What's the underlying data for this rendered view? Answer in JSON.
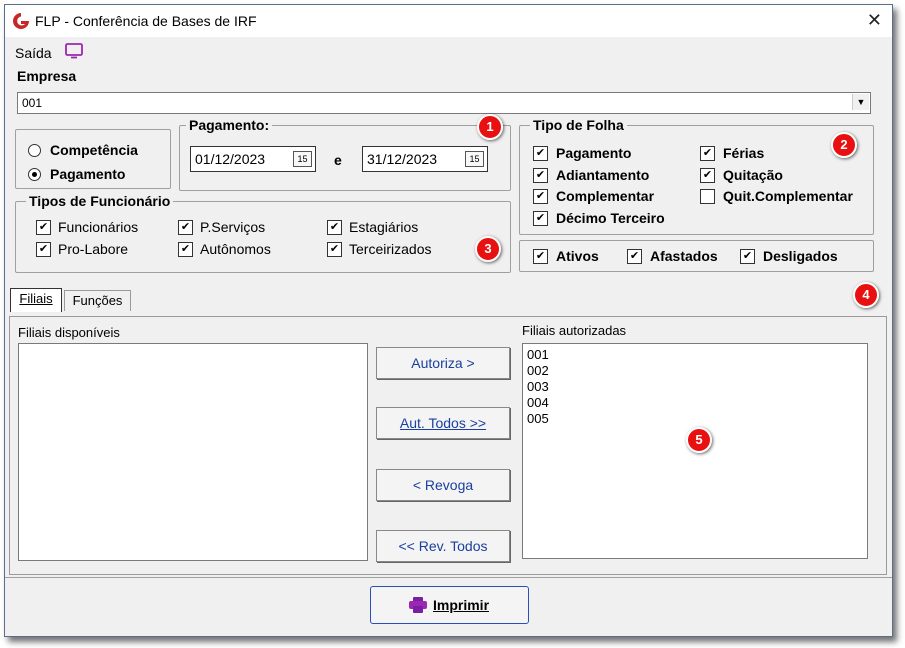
{
  "window": {
    "title": "FLP - Conferência de Bases de IRF",
    "close": "✕"
  },
  "menu": {
    "saida": "Saída"
  },
  "empresa": {
    "label": "Empresa",
    "value": "001"
  },
  "periodo": {
    "competencia": "Competência",
    "pagamento": "Pagamento",
    "selected": "Pagamento"
  },
  "pagamento": {
    "title": "Pagamento:",
    "date_from": "01/12/2023",
    "conj": "e",
    "date_to": "31/12/2023",
    "cal_icon": "15"
  },
  "tipo_folha": {
    "title": "Tipo de Folha",
    "items": [
      {
        "label": "Pagamento",
        "checked": true
      },
      {
        "label": "Adiantamento",
        "checked": true
      },
      {
        "label": "Complementar",
        "checked": true
      },
      {
        "label": "Décimo Terceiro",
        "checked": true
      },
      {
        "label": "Férias",
        "checked": true
      },
      {
        "label": "Quitação",
        "checked": true
      },
      {
        "label": "Quit.Complementar",
        "checked": false
      }
    ]
  },
  "tipos_funcionario": {
    "title": "Tipos de Funcionário",
    "items": [
      {
        "label": "Funcionários",
        "checked": true
      },
      {
        "label": "Pro-Labore",
        "checked": true
      },
      {
        "label": "P.Serviços",
        "checked": true
      },
      {
        "label": "Autônomos",
        "checked": true
      },
      {
        "label": "Estagiários",
        "checked": true
      },
      {
        "label": "Terceirizados",
        "checked": true
      }
    ]
  },
  "situacao": {
    "items": [
      {
        "label": "Ativos",
        "checked": true
      },
      {
        "label": "Afastados",
        "checked": true
      },
      {
        "label": "Desligados",
        "checked": true
      }
    ]
  },
  "tabs": {
    "filiais": "Filiais",
    "funcoes": "Funções"
  },
  "filiais": {
    "disponiveis_label": "Filiais disponíveis",
    "autorizadas_label": "Filiais autorizadas",
    "autorizadas": [
      "001",
      "002",
      "003",
      "004",
      "005"
    ]
  },
  "buttons": {
    "autoriza": "Autoriza >",
    "aut_todos": "Aut. Todos >>",
    "revoga": "< Revoga",
    "rev_todos": "<< Rev. Todos",
    "imprimir": "Imprimir"
  },
  "badges": [
    "1",
    "2",
    "3",
    "4",
    "5"
  ],
  "colors": {
    "badge": "#e81010",
    "accent": "#2a4fb8",
    "logo": "#c62828",
    "printer": "#9c27b0"
  }
}
